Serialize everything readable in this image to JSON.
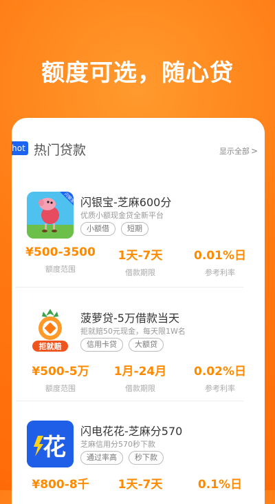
{
  "headline": "额度可选，随心贷",
  "section": {
    "hot_tag": "hot",
    "title": "热门贷款",
    "show_all": "显示全部",
    "chevron": ">"
  },
  "stat_labels": {
    "amount": "额度范围",
    "term": "借款期限",
    "rate": "参考利率"
  },
  "loans": [
    {
      "name": "闪银宝-芝麻600分",
      "desc": "优质小额现金贷全新平台",
      "tags": [
        "小额借",
        "短期"
      ],
      "amount": "¥500-3500",
      "term": "1天-7天",
      "rate": "0.01%日",
      "logo_icon": "pig-cartoon-icon",
      "logo_badge": "闪银宝"
    },
    {
      "name": "菠萝贷-5万借款当天",
      "desc": "拒就赔50元现金，每天限1W名",
      "tags": [
        "信用卡贷",
        "大额贷"
      ],
      "amount": "¥500-5万",
      "term": "1月-24月",
      "rate": "0.02%日",
      "logo_icon": "pineapple-coin-icon",
      "logo_text": "拒就赔"
    },
    {
      "name": "闪电花花-芝麻分570",
      "desc": "芝麻信用分570秒下款",
      "tags": [
        "通过率高",
        "秒下款"
      ],
      "amount": "¥800-8千",
      "term": "1天-7天",
      "rate": "0.1%日",
      "logo_icon": "lightning-hua-icon",
      "logo_text": "花"
    }
  ],
  "colors": {
    "accent": "#ff8a00",
    "bg_orange": "#ff7a12",
    "hot_blue": "#1c63f2",
    "hua_blue": "#1f5fe8"
  }
}
